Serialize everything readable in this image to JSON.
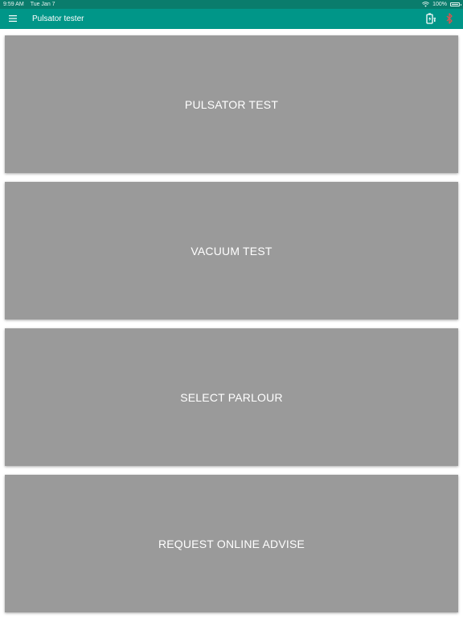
{
  "status_bar": {
    "time": "9:59 AM",
    "date": "Tue Jan 7",
    "battery": "100%",
    "wifi_icon": "wifi-icon",
    "battery_icon": "battery-icon"
  },
  "app_bar": {
    "title": "Pulsator tester",
    "menu_icon": "menu-icon",
    "plug_icon": "battery-plug-icon",
    "bluetooth_icon": "bluetooth-icon",
    "colors": {
      "app_bar": "#009688",
      "status_bar": "#0a7c6c",
      "bluetooth_icon": "#d9534f"
    }
  },
  "tiles": [
    {
      "label": "PULSATOR TEST"
    },
    {
      "label": "VACUUM TEST"
    },
    {
      "label": "SELECT PARLOUR"
    },
    {
      "label": "REQUEST ONLINE ADVISE"
    }
  ],
  "tile_color": "#9a9a9a"
}
